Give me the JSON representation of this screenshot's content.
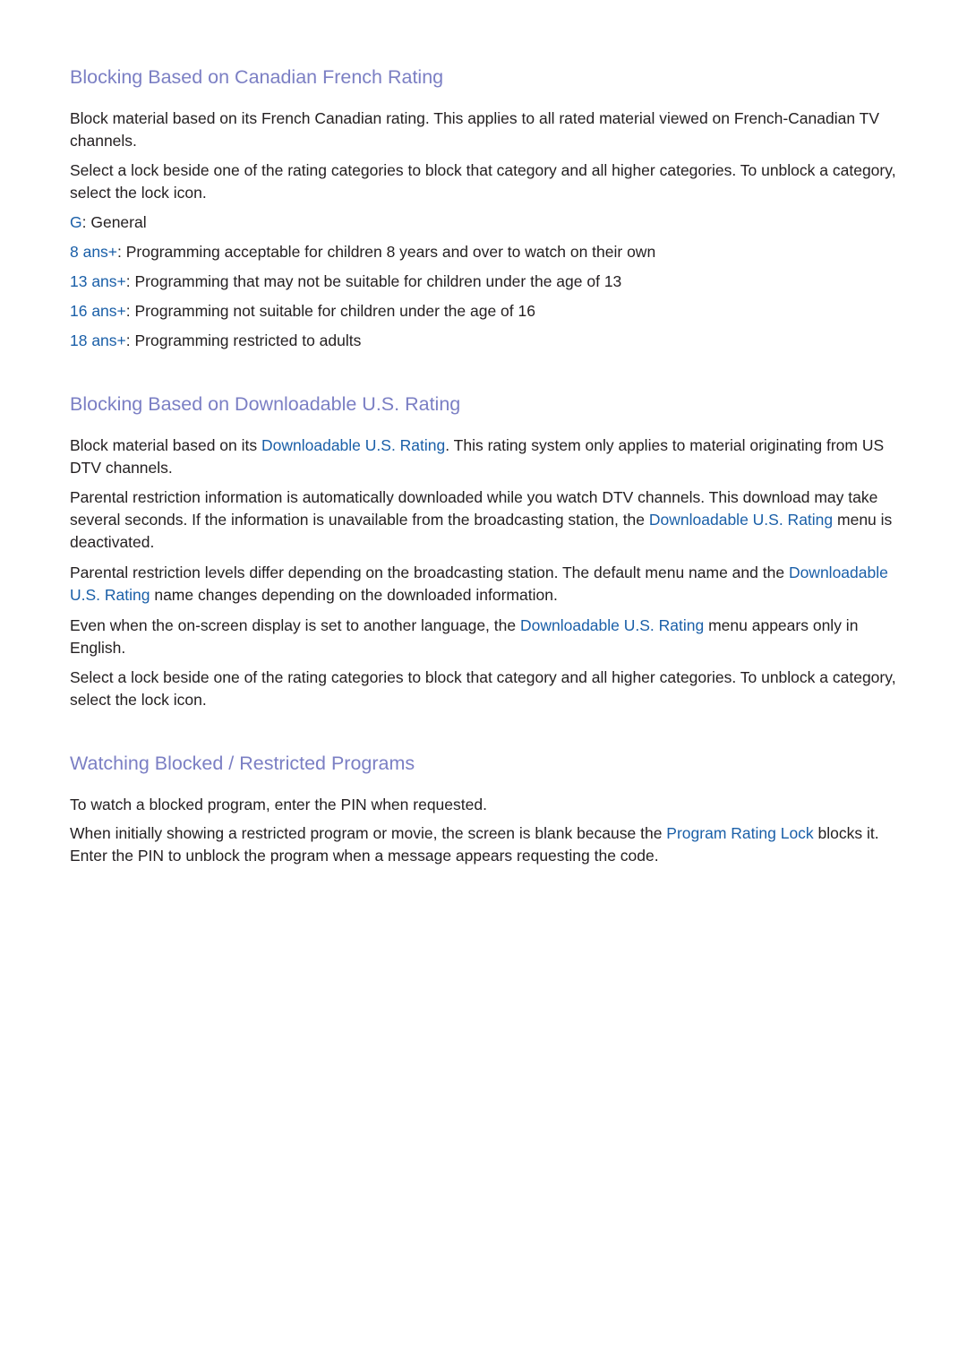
{
  "sections": [
    {
      "heading": "Blocking Based on Canadian French Rating",
      "paragraphs": [
        "Block material based on its French Canadian rating. This applies to all rated material viewed on French-Canadian TV channels.",
        "Select a lock beside one of the rating categories to block that category and all higher categories. To unblock a category, select the lock icon."
      ],
      "ratings": [
        {
          "code": "G",
          "desc": ": General"
        },
        {
          "code": "8 ans+",
          "desc": ": Programming acceptable for children 8 years and over to watch on their own"
        },
        {
          "code": "13 ans+",
          "desc": ": Programming that may not be suitable for children under the age of 13"
        },
        {
          "code": "16 ans+",
          "desc": ": Programming not suitable for children under the age of 16"
        },
        {
          "code": "18 ans+",
          "desc": ": Programming restricted to adults"
        }
      ]
    },
    {
      "heading": "Blocking Based on Downloadable U.S. Rating",
      "p1": {
        "a": "Block material based on its ",
        "link": "Downloadable U.S. Rating",
        "b": ". This rating system only applies to material originating from US DTV channels."
      },
      "p2": {
        "a": "Parental restriction information is automatically downloaded while you watch DTV channels. This download may take several seconds. If the information is unavailable from the broadcasting station, the ",
        "link": "Downloadable U.S. Rating",
        "b": " menu is deactivated."
      },
      "p3": {
        "a": "Parental restriction levels differ depending on the broadcasting station. The default menu name and the ",
        "link": "Downloadable U.S. Rating",
        "b": " name changes depending on the downloaded information."
      },
      "p4": {
        "a": "Even when the on-screen display is set to another language, the ",
        "link": "Downloadable U.S. Rating",
        "b": " menu appears only in English."
      },
      "p5": "Select a lock beside one of the rating categories to block that category and all higher categories. To unblock a category, select the lock icon."
    },
    {
      "heading": "Watching Blocked / Restricted Programs",
      "p1": "To watch a blocked program, enter the PIN when requested.",
      "p2": {
        "a": "When initially showing a restricted program or movie, the screen is blank because the ",
        "link": "Program Rating Lock",
        "b": " blocks it. Enter the PIN to unblock the program when a message appears requesting the code."
      }
    }
  ],
  "colors": {
    "heading": "#7b7fc4",
    "link": "#1a5fa8",
    "text": "#231f20"
  }
}
